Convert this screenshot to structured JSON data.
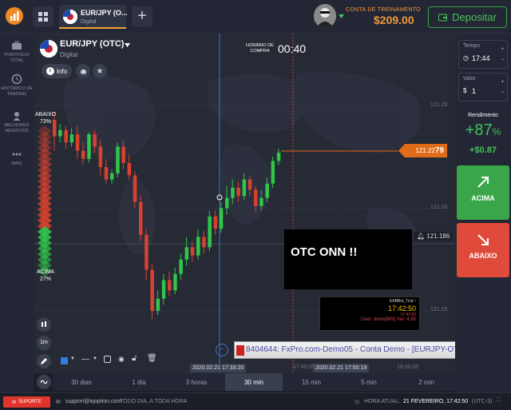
{
  "header": {
    "tab": {
      "title": "EUR/JPY (O...",
      "subtitle": "Digital"
    },
    "account_label": "CONTA DE TREINAMENTO",
    "balance": "$209.00",
    "deposit_label": "Depositar"
  },
  "sidebar": {
    "items": [
      {
        "label": "PORTFÓLIO TOTAL",
        "icon": "briefcase-icon"
      },
      {
        "label": "HISTÓRICO DE TRADING",
        "icon": "history-icon"
      },
      {
        "label": "MELHORES NEGÓCIOS",
        "icon": "trophy-icon"
      },
      {
        "label": "MAIS",
        "icon": "more-icon"
      }
    ]
  },
  "asset": {
    "title": "EUR/JPY (OTC)",
    "subtitle": "Digital",
    "info_label": "Info"
  },
  "chart": {
    "expiry_label_1": "HORÁRIO DE",
    "expiry_label_2": "COMPRA",
    "expiry_time": "00:40",
    "y_labels": [
      "121.25",
      "121.20",
      "121.15"
    ],
    "current_price_main": "121.22",
    "current_price_bold": "79",
    "alert_price": "121.186",
    "abaixo_label": "ABAIXO",
    "abaixo_pct": "73%",
    "acima_label": "ACIMA",
    "acima_pct": "27%",
    "time_tag_left": "2020.02.21 17:33:20",
    "time_tag_right": "2020.02.21 17:50:19",
    "x_labels": [
      "17:45:00",
      "18:00:00"
    ],
    "colors": {
      "up": "#2fc64a",
      "down": "#d8412f",
      "accent": "#e06c1a"
    }
  },
  "overlays": {
    "otc_text": "OTC ONN !!",
    "mini_window": {
      "line1": "EABBot_Tick\u0000",
      "time": "17:42:50",
      "line3": "17:42:50",
      "line4": "User: demo[MS] Ver: 4.85"
    },
    "fxpro_title": "8404644: FxPro.com-Demo05 - Conta Demo - [EURJPY-OTC,M1 (offline)]"
  },
  "toolbar": {
    "left_buttons": [
      "1m"
    ],
    "timeframes": [
      {
        "label": "30 dias",
        "active": false
      },
      {
        "label": "1 dia",
        "active": false
      },
      {
        "label": "3 horas",
        "active": false
      },
      {
        "label": "30 min",
        "active": true
      },
      {
        "label": "15 min",
        "active": false
      },
      {
        "label": "5 min",
        "active": false
      },
      {
        "label": "2 min",
        "active": false
      }
    ]
  },
  "right_panel": {
    "tempo_label": "Tempo",
    "tempo_value": "17:44",
    "valor_label": "Valor",
    "valor_symbol": "$",
    "valor_value": "1",
    "rendimento_label": "Rendimento",
    "rendimento_pct": "+87",
    "rendimento_pct_sign": "%",
    "rendimento_amount": "+$0.87",
    "acima_label": "ACIMA",
    "abaixo_label": "ABAIXO"
  },
  "status_bar": {
    "suporte": "SUPORTE",
    "email": "support@iqoption.com",
    "hours": "TODO DIA, A TODA HORA",
    "time_label": "HORA ATUAL:",
    "time_value": "21 FEVEREIRO, 17:42:50",
    "tz": "(UTC-3)"
  },
  "candles": [
    {
      "o": 121.243,
      "c": 121.235,
      "h": 121.247,
      "l": 121.228
    },
    {
      "o": 121.235,
      "c": 121.238,
      "h": 121.241,
      "l": 121.232
    },
    {
      "o": 121.238,
      "c": 121.232,
      "h": 121.24,
      "l": 121.229
    },
    {
      "o": 121.232,
      "c": 121.236,
      "h": 121.239,
      "l": 121.23
    },
    {
      "o": 121.236,
      "c": 121.228,
      "h": 121.24,
      "l": 121.224
    },
    {
      "o": 121.228,
      "c": 121.224,
      "h": 121.232,
      "l": 121.221
    },
    {
      "o": 121.224,
      "c": 121.236,
      "h": 121.237,
      "l": 121.222
    },
    {
      "o": 121.236,
      "c": 121.23,
      "h": 121.238,
      "l": 121.227
    },
    {
      "o": 121.23,
      "c": 121.22,
      "h": 121.233,
      "l": 121.216
    },
    {
      "o": 121.22,
      "c": 121.214,
      "h": 121.224,
      "l": 121.212
    },
    {
      "o": 121.214,
      "c": 121.217,
      "h": 121.219,
      "l": 121.212
    },
    {
      "o": 121.217,
      "c": 121.23,
      "h": 121.232,
      "l": 121.215
    },
    {
      "o": 121.23,
      "c": 121.222,
      "h": 121.233,
      "l": 121.219
    },
    {
      "o": 121.222,
      "c": 121.216,
      "h": 121.226,
      "l": 121.214
    },
    {
      "o": 121.216,
      "c": 121.203,
      "h": 121.218,
      "l": 121.2
    },
    {
      "o": 121.203,
      "c": 121.187,
      "h": 121.206,
      "l": 121.184
    },
    {
      "o": 121.187,
      "c": 121.17,
      "h": 121.19,
      "l": 121.165
    },
    {
      "o": 121.17,
      "c": 121.15,
      "h": 121.173,
      "l": 121.146
    },
    {
      "o": 121.15,
      "c": 121.156,
      "h": 121.16,
      "l": 121.148
    },
    {
      "o": 121.156,
      "c": 121.165,
      "h": 121.168,
      "l": 121.153
    },
    {
      "o": 121.165,
      "c": 121.16,
      "h": 121.169,
      "l": 121.157
    },
    {
      "o": 121.16,
      "c": 121.168,
      "h": 121.171,
      "l": 121.158
    },
    {
      "o": 121.168,
      "c": 121.175,
      "h": 121.178,
      "l": 121.165
    },
    {
      "o": 121.175,
      "c": 121.181,
      "h": 121.186,
      "l": 121.172
    },
    {
      "o": 121.181,
      "c": 121.177,
      "h": 121.184,
      "l": 121.174
    },
    {
      "o": 121.177,
      "c": 121.186,
      "h": 121.19,
      "l": 121.175
    },
    {
      "o": 121.186,
      "c": 121.181,
      "h": 121.189,
      "l": 121.178
    },
    {
      "o": 121.181,
      "c": 121.196,
      "h": 121.199,
      "l": 121.179
    },
    {
      "o": 121.196,
      "c": 121.19,
      "h": 121.199,
      "l": 121.187
    },
    {
      "o": 121.19,
      "c": 121.2,
      "h": 121.203,
      "l": 121.188
    },
    {
      "o": 121.2,
      "c": 121.205,
      "h": 121.211,
      "l": 121.197
    },
    {
      "o": 121.205,
      "c": 121.21,
      "h": 121.214,
      "l": 121.202
    },
    {
      "o": 121.21,
      "c": 121.206,
      "h": 121.213,
      "l": 121.203
    },
    {
      "o": 121.206,
      "c": 121.214,
      "h": 121.217,
      "l": 121.204
    },
    {
      "o": 121.214,
      "c": 121.209,
      "h": 121.216,
      "l": 121.206
    },
    {
      "o": 121.209,
      "c": 121.201,
      "h": 121.211,
      "l": 121.198
    },
    {
      "o": 121.201,
      "c": 121.205,
      "h": 121.209,
      "l": 121.199
    },
    {
      "o": 121.205,
      "c": 121.212,
      "h": 121.215,
      "l": 121.203
    },
    {
      "o": 121.212,
      "c": 121.223,
      "h": 121.225,
      "l": 121.21
    },
    {
      "o": 121.223,
      "c": 121.227,
      "h": 121.229,
      "l": 121.221
    }
  ]
}
